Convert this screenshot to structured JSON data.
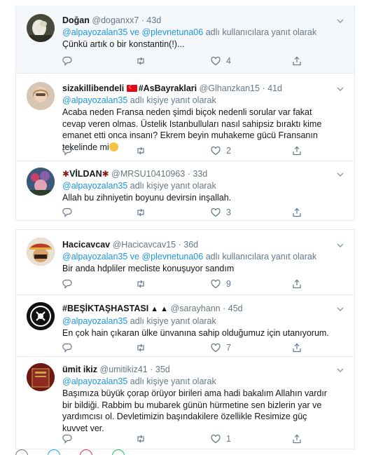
{
  "tweets_top": [
    {
      "name": "Doğan",
      "handle": "@doganxx7",
      "time": "· 43d",
      "reply_prefix": "",
      "reply_users": "@alpayozalan35 ve @plevnetuna06",
      "reply_suffix": " adlı kullanıcılara yanıt olarak",
      "text": "Çünkü artık o bir konstantin(!)...",
      "likes": "4"
    },
    {
      "name_pre": "sizakillibendeli",
      "name_post": "#AsBayraklari",
      "handle": "@Glhanzkan15",
      "time": "· 41d",
      "reply_users": "@alpayozalan35",
      "reply_suffix": " adlı kişiye yanıt olarak",
      "text": "Acaba neden Fransa neden şimdi biçok nedenli sorular var fakat cevap veren olmas. Üstelik Istanbulluları nasıl sahipsiz bıraktı kime emanet etti onca insanı? Ekrem beyin muhakeme gücü Fransanın tekelinde mi",
      "likes": "2"
    },
    {
      "name": "VİLDAN",
      "handle": "@MRSU10410963",
      "time": "· 33d",
      "reply_users": "@alpayozalan35",
      "reply_suffix": " adlı kişiye yanıt olarak",
      "text": "Allah bu zihniyetin boyunu devirsin inşallah.",
      "likes": "3"
    }
  ],
  "tweets_bottom": [
    {
      "name": "Hacicavcav",
      "handle": "@Hacicavcav15",
      "time": "· 36d",
      "reply_users": "@alpayozalan35 ve @plevnetuna06",
      "reply_suffix": " adlı kullanıcılara yanıt olarak",
      "text": "Bir anda hdpliler  mecliste konuşuyor sandım",
      "likes": "9"
    },
    {
      "name": "#BEŞİKTAŞHASTASI",
      "handle": "@sarayhann",
      "time": "· 45d",
      "reply_users": "@alpayozalan35",
      "reply_suffix": " adlı kişiye yanıt olarak",
      "text": "En çok hain çıkaran ülke ünvanına sahip olduğumuz için utanıyorum.",
      "likes": "7"
    },
    {
      "name": "ümit ikiz",
      "handle": "@umitikiz41",
      "time": "· 35d",
      "reply_users": "@alpayozalan35",
      "reply_suffix": " adlı kişiye yanıt olarak",
      "text": "Başımıza büyük çorap örüyor birileri ama hadi bakalım Allahın vardır bir bildiği. Rabbim bu mubarek günün hürmetine sen bizlerin yar ve yardımcısı ol. Devletimizin başındakilere özellikle Resimize güç kuvvet ver.",
      "likes": "1"
    }
  ],
  "icons": {
    "reply": "reply-icon",
    "retweet": "retweet-icon",
    "like": "like-icon",
    "share": "share-icon",
    "more": "chevron-down-icon"
  },
  "colors": {
    "link": "#1b95e0",
    "muted": "#657786",
    "highlight_bg": "#f5f8fa"
  }
}
